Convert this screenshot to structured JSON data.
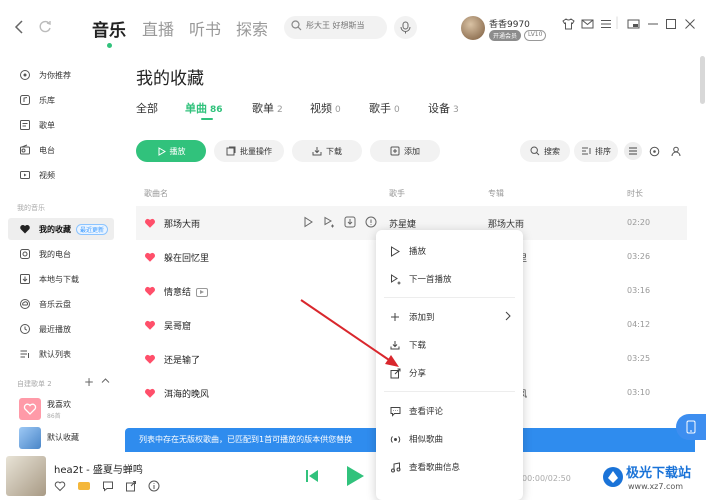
{
  "topbar": {
    "tabs": [
      "音乐",
      "直播",
      "听书",
      "探索"
    ],
    "active_tab": "音乐",
    "search_placeholder": "彤大王 好想斯当",
    "username": "香香9970",
    "vip_badge": "开通会员",
    "level_badge": "LV10"
  },
  "sidebar": {
    "online_items": [
      "为你推荐",
      "乐库",
      "歌单",
      "电台",
      "视频"
    ],
    "my_music_label": "我的音乐",
    "my_items": [
      "我的收藏",
      "我的电台",
      "本地与下载",
      "音乐云盘",
      "最近播放",
      "默认列表"
    ],
    "active_item": "我的收藏",
    "active_tag": "最近更新",
    "custom_label": "自建歌单 2",
    "playlists": [
      {
        "name": "我喜欢",
        "count": "86首"
      },
      {
        "name": "默认收藏",
        "count": ""
      }
    ]
  },
  "main": {
    "title": "我的收藏",
    "subtabs": [
      {
        "label": "全部",
        "count": ""
      },
      {
        "label": "单曲",
        "count": "86"
      },
      {
        "label": "歌单",
        "count": "2"
      },
      {
        "label": "视频",
        "count": "0"
      },
      {
        "label": "歌手",
        "count": "0"
      },
      {
        "label": "设备",
        "count": "3"
      }
    ],
    "actions": {
      "play": "播放",
      "batch": "批量操作",
      "download": "下载",
      "add": "添加",
      "search": "搜索",
      "sort": "排序"
    },
    "columns": {
      "song": "歌曲名",
      "artist": "歌手",
      "album": "专辑",
      "duration": "时长"
    },
    "rows": [
      {
        "song": "那场大雨",
        "artist": "苏星婕",
        "album": "那场大雨",
        "duration": "02:20",
        "mv": false
      },
      {
        "song": "躲在回忆里",
        "artist": "",
        "album": "里",
        "duration": "03:26",
        "mv": false
      },
      {
        "song": "情意结",
        "artist": "",
        "album": "",
        "duration": "03:16",
        "mv": true
      },
      {
        "song": "吴哥窟",
        "artist": "",
        "album": "",
        "duration": "04:12",
        "mv": false
      },
      {
        "song": "还是输了",
        "artist": "",
        "album": "",
        "duration": "03:25",
        "mv": false
      },
      {
        "song": "洱海的晚风",
        "artist": "",
        "album": "风",
        "duration": "03:10",
        "mv": false
      }
    ],
    "banner": "列表中存在无版权歌曲，已匹配到1首可播放的版本供您替换"
  },
  "context_menu": {
    "items": [
      "播放",
      "下一首播放",
      "添加到",
      "下载",
      "分享",
      "查看评论",
      "相似歌曲",
      "查看歌曲信息"
    ]
  },
  "player": {
    "song": "hea2t - 盛夏与蝉鸣",
    "time": "00:00/02:50"
  },
  "watermark": {
    "title": "极光下载站",
    "url": "www.xz7.com"
  },
  "colors": {
    "accent": "#31c27c",
    "heart": "#ff4f6a",
    "banner": "#2f8cee",
    "arrow": "#d9272d"
  }
}
